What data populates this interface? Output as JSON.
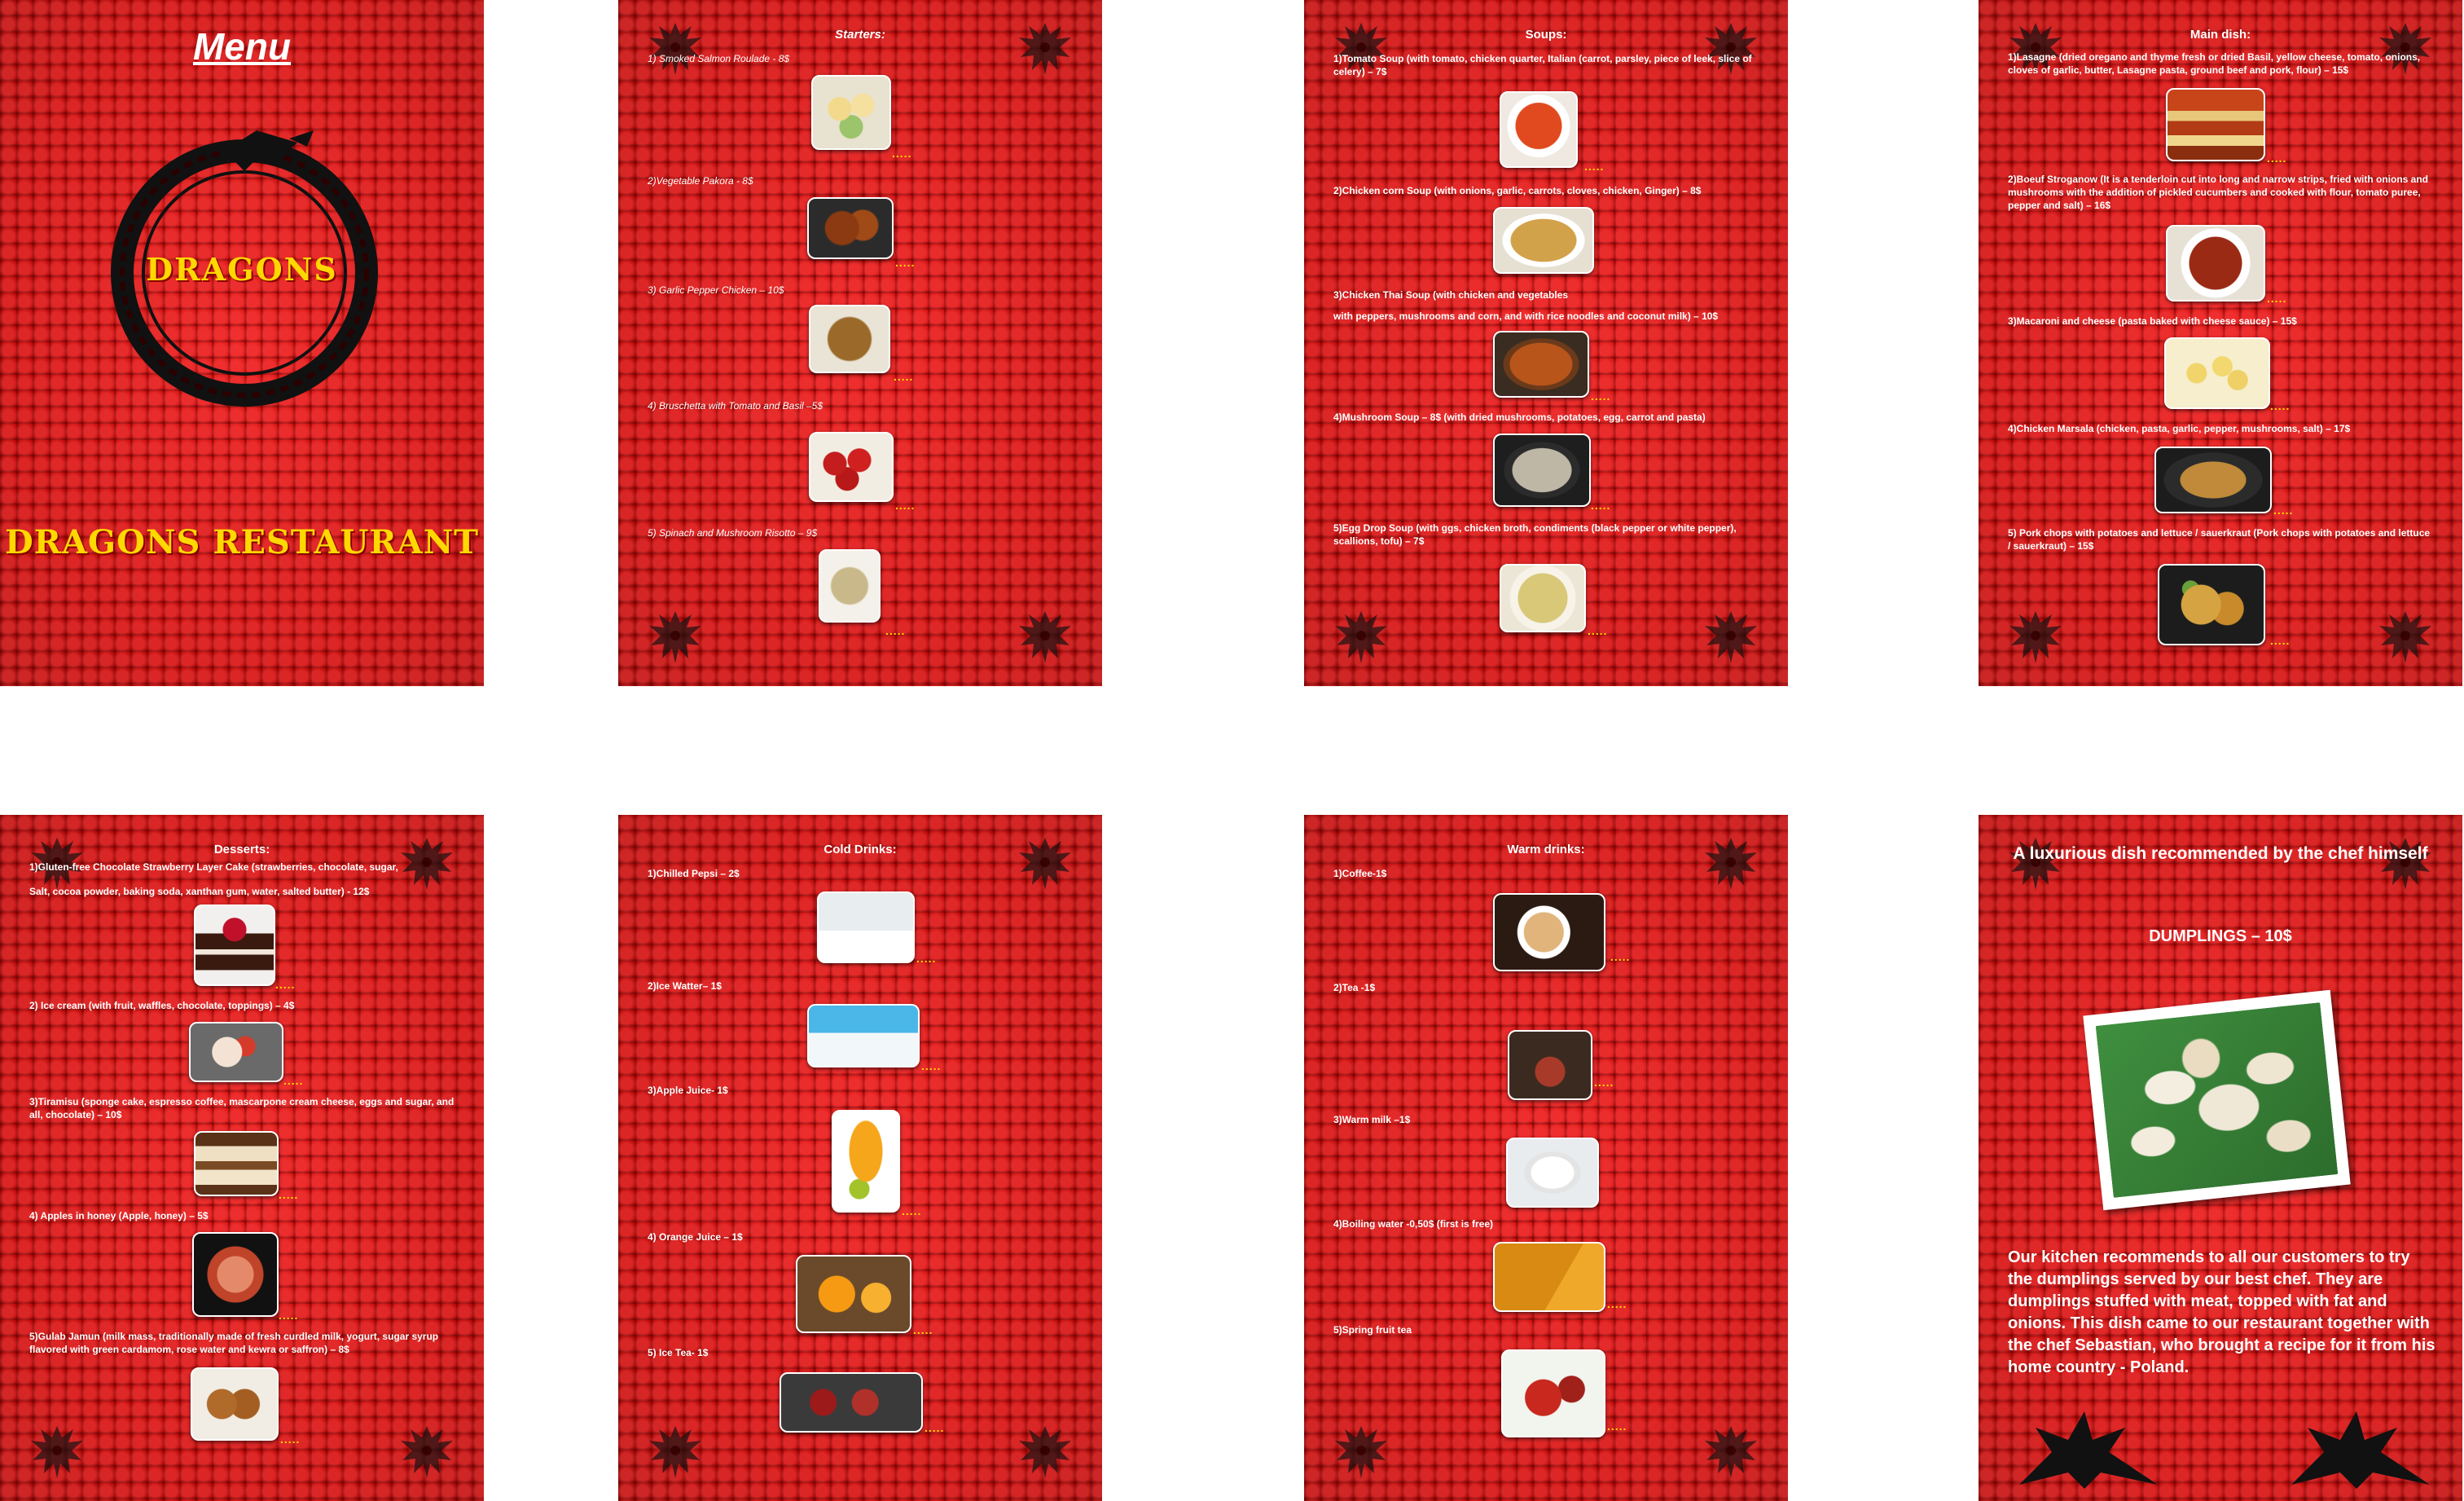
{
  "cover": {
    "menu_title": "Menu",
    "brand_ring": "DRAGONS",
    "brand_full": "DRAGONS RESTAURANT"
  },
  "starters": {
    "title": "Starters:",
    "items": [
      {
        "label": "1) Smoked Salmon Roulade -  8$",
        "dots": "....."
      },
      {
        "label": "2)Vegetable Pakora  -  8$",
        "dots": "....."
      },
      {
        "label": "3) Garlic Pepper Chicken – 10$",
        "dots": "....."
      },
      {
        "label": "4) Bruschetta with Tomato and Basil –5$",
        "dots": "....."
      },
      {
        "label": "5) Spinach and Mushroom Risotto – 9$",
        "dots": "....."
      }
    ]
  },
  "soups": {
    "title": "Soups:",
    "items": [
      {
        "label": "1)Tomato Soup (with tomato, chicken quarter,  Italian (carrot, parsley, piece of leek, slice of celery) – 7$",
        "dots": "....."
      },
      {
        "label": "2)Chicken corn Soup (with onions, garlic, carrots, cloves, chicken, Ginger) – 8$",
        "dots": "....."
      },
      {
        "label": "3)Chicken Thai Soup (with chicken and vegetables",
        "label2": "with peppers, mushrooms and corn, and with rice noodles and coconut milk) – 10$",
        "dots": "....."
      },
      {
        "label": "4)Mushroom Soup – 8$ (with dried mushrooms, potatoes, egg, carrot and pasta)",
        "dots": "....."
      },
      {
        "label": "5)Egg Drop Soup (with ggs, chicken broth, condiments (black pepper or white pepper), scallions, tofu) – 7$",
        "dots": "....."
      }
    ]
  },
  "main": {
    "title": "Main dish:",
    "items": [
      {
        "label": "1)Lasagne (dried oregano and thyme fresh or dried Basil, yellow cheese, tomato, onions, cloves of garlic, butter, Lasagne pasta, ground beef and pork, flour) – 15$",
        "dots": "....."
      },
      {
        "label": "2)Boeuf Stroganow (It is a tenderloin cut into long and narrow strips, fried with onions and mushrooms with the addition of pickled cucumbers and cooked with flour, tomato puree, pepper and salt) – 16$",
        "dots": "....."
      },
      {
        "label": "3)Macaroni and cheese (pasta baked with cheese sauce) – 15$",
        "dots": "....."
      },
      {
        "label": "4)Chicken Marsala (chicken, pasta, garlic, pepper, mushrooms, salt) – 17$",
        "dots": "....."
      },
      {
        "label": "5) Pork chops with potatoes and lettuce / sauerkraut (Pork chops with potatoes and lettuce / sauerkraut) – 15$",
        "dots": "....."
      }
    ]
  },
  "desserts": {
    "title": "Desserts:",
    "items": [
      {
        "label": "1)Gluten-free Chocolate Strawberry Layer Cake (strawberries, chocolate, sugar,",
        "label2": "Salt, cocoa powder, baking soda, xanthan gum, water, salted butter) -  12$",
        "dots": "....."
      },
      {
        "label": "2) Ice cream (with fruit, waffles, chocolate, toppings) – 4$",
        "dots": "....."
      },
      {
        "label": "3)Tiramisu (sponge cake, espresso coffee, mascarpone cream cheese, eggs and sugar, and all, chocolate) – 10$",
        "dots": "....."
      },
      {
        "label": "4) Apples in honey (Apple, honey) – 5$",
        "dots": "....."
      },
      {
        "label": "5)Gulab Jamun (milk mass, traditionally made of fresh curdled milk, yogurt, sugar syrup flavored with green cardamom, rose water and kewra or saffron) – 8$",
        "dots": "....."
      }
    ]
  },
  "cold": {
    "title": "Cold Drinks:",
    "items": [
      {
        "label": "1)Chilled Pepsi – 2$",
        "dots": "....."
      },
      {
        "label": "2)Ice Watter– 1$",
        "dots": "....."
      },
      {
        "label": "3)Apple Juice- 1$",
        "dots": "....."
      },
      {
        "label": "4) Orange Juice – 1$",
        "dots": "....."
      },
      {
        "label": "5) Ice Tea- 1$",
        "dots": "....."
      }
    ]
  },
  "warm": {
    "title": "Warm drinks:",
    "items": [
      {
        "label": "1)Coffee-1$",
        "dots": "....."
      },
      {
        "label": "2)Tea -1$",
        "dots": "....."
      },
      {
        "label": "3)Warm milk –1$",
        "dots": "....."
      },
      {
        "label": "4)Boiling water -0,50$ (first is free)",
        "dots": "....."
      },
      {
        "label": "5)Spring fruit tea",
        "dots": "....."
      }
    ]
  },
  "chef": {
    "title": "A luxurious dish recommended by the chef himself",
    "dish": "DUMPLINGS – 10$",
    "text": "Our kitchen recommends to all our customers to try the dumplings served by our best chef. They are dumplings stuffed with meat, topped with fat and onions. This dish came to our restaurant together with the chef Sebastian, who brought a recipe for it from his home country - Poland."
  }
}
